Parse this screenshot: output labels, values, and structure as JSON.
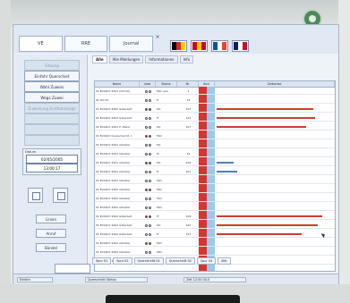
{
  "window": {
    "tabs": [
      {
        "label": "VE"
      },
      {
        "label": "RRE"
      },
      {
        "label": "Journal"
      }
    ],
    "close_glyph": "×"
  },
  "flags": [
    {
      "name": "flag-de",
      "colors": [
        "#000000",
        "#d52b1e",
        "#ffcc00"
      ]
    },
    {
      "name": "flag-es",
      "colors": [
        "#c60b1e",
        "#ffc400",
        "#c60b1e"
      ]
    },
    {
      "name": "flag-fr",
      "colors": [
        "#0055a4",
        "#ffffff",
        "#ef4135"
      ]
    },
    {
      "name": "flag-uk",
      "colors": [
        "#012169",
        "#ffffff",
        "#c8102e"
      ]
    }
  ],
  "left_panel": {
    "buttons": [
      {
        "label": "Sitzung",
        "dim": true
      },
      {
        "label": "Einfahr Querschiet",
        "dim": false
      },
      {
        "label": "Wahl Zuweis",
        "dim": false
      },
      {
        "label": "Wegs Zuwei",
        "dim": false
      },
      {
        "label": "Zuweisung Erstfahrzeuge",
        "dim": true
      },
      {
        "label": "",
        "dim": true
      },
      {
        "label": "",
        "dim": true
      },
      {
        "label": "",
        "dim": true
      }
    ],
    "date_label": "Datum",
    "date_value": "02/05/2005",
    "time_value": "13:00:17",
    "small_buttons": [
      {
        "label": "Linien"
      },
      {
        "label": "Anruf"
      },
      {
        "label": "Bündel"
      }
    ]
  },
  "main_tabs": [
    {
      "label": "Alle",
      "active": true
    },
    {
      "label": "Alle Meldungen",
      "active": false
    },
    {
      "label": "Informationen",
      "active": false
    },
    {
      "label": "Info",
      "active": false
    }
  ],
  "grid": {
    "columns": [
      "Name",
      "Lead",
      "Status",
      "Nr",
      "Ausl",
      "Zeitachse"
    ],
    "rows": [
      {
        "name": "01 Einfahrt 2001 (Ort 02)",
        "status": "Fahr Ank",
        "nr": "1",
        "bar": 0.0,
        "color": "red"
      },
      {
        "name": "01 Ort 02",
        "status": "Fr",
        "nr": "14",
        "bar": 0.0,
        "color": "red"
      },
      {
        "name": "01 Einfahrt 2002 Güterzeit",
        "status": "Pol",
        "nr": "107",
        "bar": 0.84,
        "color": "red"
      },
      {
        "name": "01 Einfahrt 2002 Güterzeit",
        "status": "Fr",
        "nr": "103",
        "bar": 0.86,
        "color": "red"
      },
      {
        "name": "01 Einfahrt 2001 Fr Wanz",
        "status": "Pol",
        "nr": "107",
        "bar": 0.78,
        "color": "red"
      },
      {
        "name": "01 Einfahrt Querschet 01 c",
        "status": "Fahr",
        "nr": "",
        "bar": 0.0,
        "color": "red"
      },
      {
        "name": "01 Einfahrt 2001 Arbeiter",
        "status": "Pol",
        "nr": "",
        "bar": 0.0,
        "color": "red"
      },
      {
        "name": "01 Einfahrt 2001 Arbeiter",
        "status": "Pr",
        "nr": "14",
        "bar": 0.0,
        "color": "red"
      },
      {
        "name": "01 Einfahrt 2001 Arbeiter",
        "status": "Pol",
        "nr": "106",
        "bar": 0.15,
        "color": "blue"
      },
      {
        "name": "01 Einfahrt 2001 Arbeiter",
        "status": "Fr",
        "nr": "107",
        "bar": 0.18,
        "color": "blue"
      },
      {
        "name": "01 Einfahrt 2001 Arbeiter",
        "status": "Fahr",
        "nr": "",
        "bar": 0.0,
        "color": "red"
      },
      {
        "name": "01 Einfahrt 2002 Arbeiter",
        "status": "Fahr",
        "nr": "",
        "bar": 0.0,
        "color": "red"
      },
      {
        "name": "01 Einfahrt 2002 Arbeiter",
        "status": "Fahr",
        "nr": "",
        "bar": 0.0,
        "color": "red"
      },
      {
        "name": "01 Einfahrt 2002 Arbeiter",
        "status": "Fahr",
        "nr": "",
        "bar": 0.0,
        "color": "red"
      },
      {
        "name": "01 Einfahrt 2002 Güterzeit",
        "status": "Fr",
        "nr": "106",
        "bar": 0.92,
        "color": "red"
      },
      {
        "name": "01 Einfahrt 2002 Güterzeit",
        "status": "Pol",
        "nr": "100",
        "bar": 0.88,
        "color": "red"
      },
      {
        "name": "01 Einfahrt 2002 Güterzeit",
        "status": "Fr",
        "nr": "107",
        "bar": 0.74,
        "color": "red"
      },
      {
        "name": "01 Einfahrt 2002 Arbeiter",
        "status": "Fahr",
        "nr": "",
        "bar": 0.0,
        "color": "red"
      },
      {
        "name": "01 Einfahrt 2002 Arbeiter",
        "status": "Fahr",
        "nr": "",
        "bar": 0.0,
        "color": "red"
      },
      {
        "name": "01 Einfahrt 2002 Arbeiter",
        "status": "Fahr",
        "nr": "",
        "bar": 0.0,
        "color": "red"
      }
    ]
  },
  "bottom_tabs": [
    {
      "label": "Spur 01"
    },
    {
      "label": "Spur 02"
    },
    {
      "label": "Querschnitt 01"
    },
    {
      "label": "Querschnitt 02"
    },
    {
      "label": "Spur 04"
    },
    {
      "label": "Alle"
    }
  ],
  "statusbar": {
    "fields": [
      {
        "label": "Einfahr"
      },
      {
        "label": "Querschnitt Status"
      },
      {
        "label": "Zeit 12:00 04.0"
      }
    ]
  },
  "colors": {
    "alarm_red": "#d7342e",
    "info_blue": "#9cc9ec",
    "bar_red": "#c8402f",
    "bar_blue": "#4d7ec2"
  }
}
